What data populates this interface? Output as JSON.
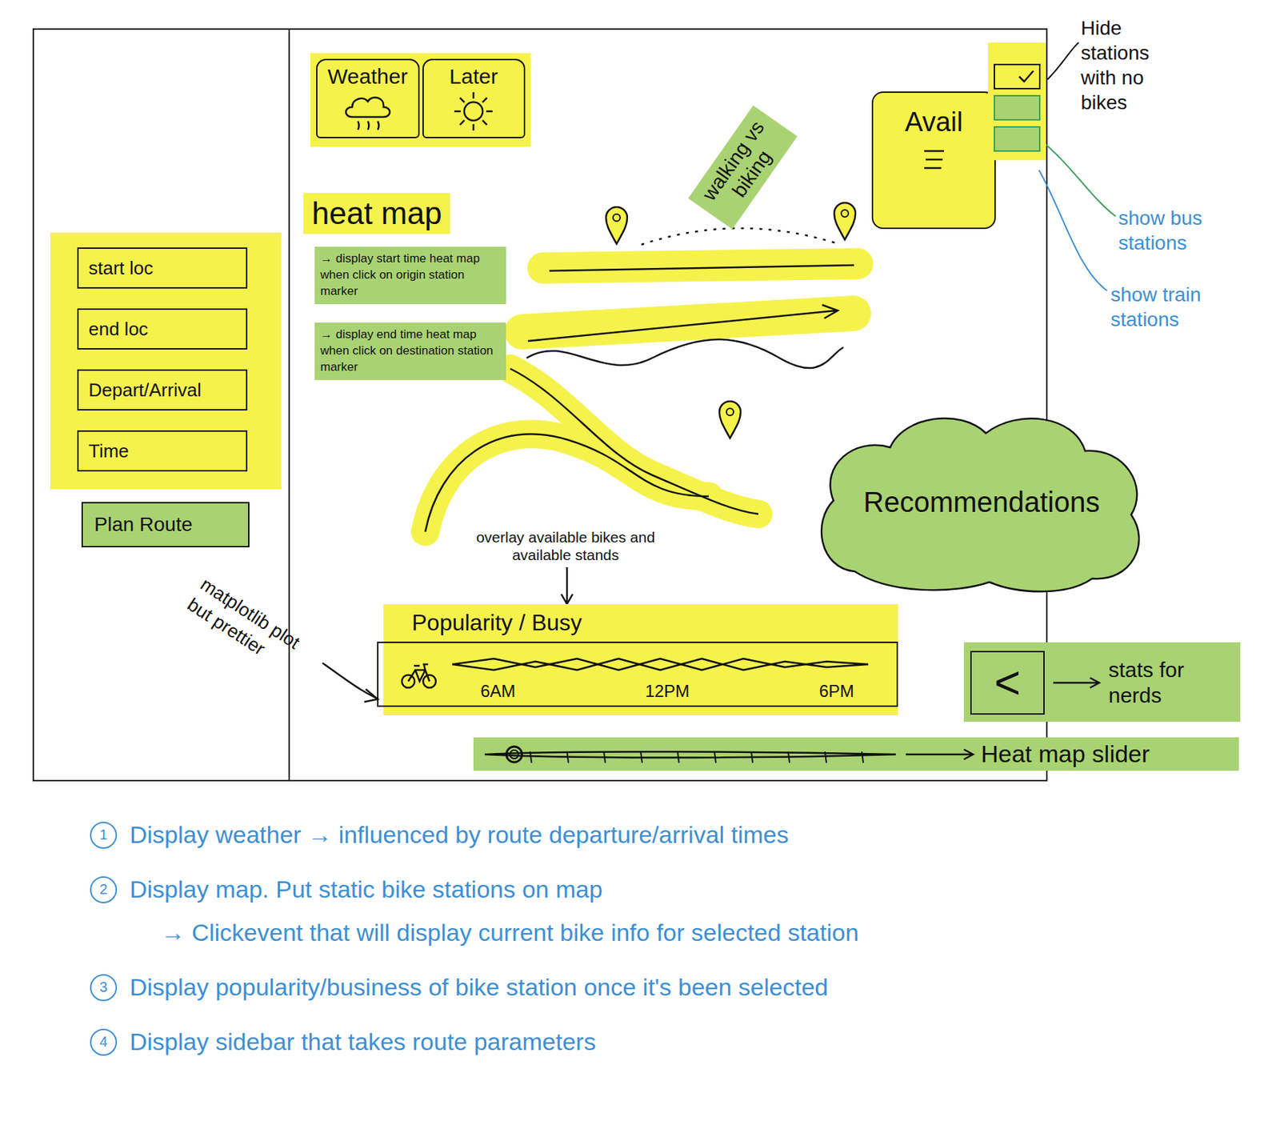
{
  "sidebar": {
    "fields": [
      {
        "label": "start loc"
      },
      {
        "label": "end loc"
      },
      {
        "label": "Depart/Arrival"
      },
      {
        "label": "Time"
      }
    ],
    "button": "Plan Route"
  },
  "weather_tabs": [
    {
      "label": "Weather",
      "kind": "rain"
    },
    {
      "label": "Later",
      "kind": "sun"
    }
  ],
  "heat_map": {
    "title": "heat map",
    "notes": [
      "→ display start time heat map when click on origin station marker",
      "→ display end time heat map when click on destination station marker"
    ]
  },
  "mode_comparison": "walking vs biking",
  "avail_panel": {
    "title": "Avail"
  },
  "layer_toggles": [
    {
      "label": "Hide stations with no bikes",
      "checked": true,
      "color": "#111111"
    },
    {
      "label": "show bus stations",
      "checked": false,
      "color": "#3d8fd4"
    },
    {
      "label": "show train stations",
      "checked": false,
      "color": "#3d8fd4"
    }
  ],
  "recommendations": {
    "title": "Recommendations"
  },
  "popularity": {
    "annotation": "overlay available bikes and available stands",
    "title": "Popularity / Busy",
    "ticks": [
      "6AM",
      "12PM",
      "6PM"
    ],
    "series": [
      {
        "name": "available bikes",
        "values": [
          5,
          7,
          4,
          7,
          3,
          7,
          3,
          7,
          4,
          6,
          5
        ]
      },
      {
        "name": "available stands",
        "values": [
          5,
          3,
          6,
          3,
          7,
          3,
          7,
          3,
          6,
          4,
          5
        ]
      }
    ]
  },
  "plot_note": "matplotlib plot but prettier",
  "stats": {
    "icon": "<",
    "label": "stats for nerds"
  },
  "heat_map_slider": {
    "label": "Heat map slider",
    "level": 0.05
  },
  "notes": [
    {
      "number": "1",
      "text": "Display weather → influenced by route departure/arrival times",
      "details": []
    },
    {
      "number": "2",
      "text": "Display map. Put static bike stations on map",
      "details": [
        "→ Clickevent that will display current bike info for selected station"
      ]
    },
    {
      "number": "3",
      "text": "Display popularity/business of bike station once it's been selected",
      "details": []
    },
    {
      "number": "4",
      "text": "Display sidebar that takes route parameters",
      "details": []
    }
  ]
}
